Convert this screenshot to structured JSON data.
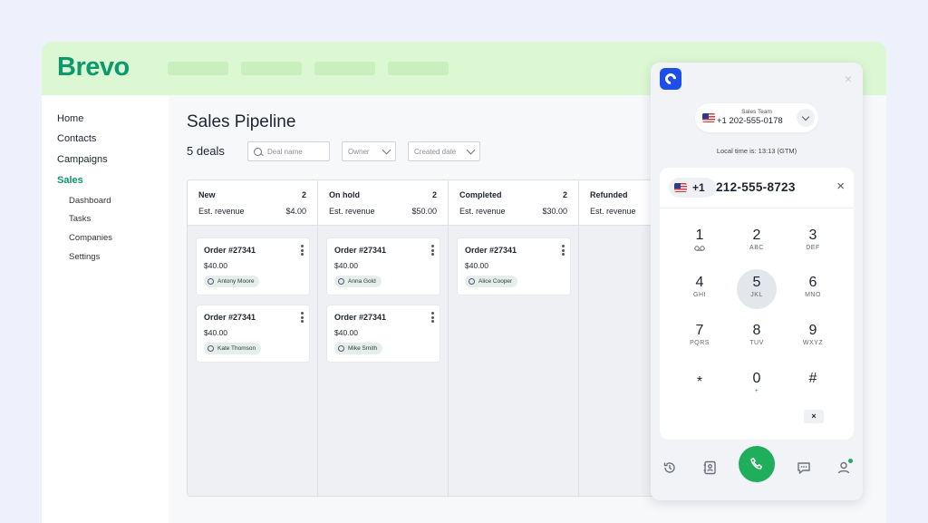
{
  "brand": {
    "logo": "Brevo"
  },
  "sidebar": {
    "items": [
      {
        "label": "Home"
      },
      {
        "label": "Contacts"
      },
      {
        "label": "Campaigns"
      },
      {
        "label": "Sales"
      }
    ],
    "sub_items": [
      {
        "label": "Dashboard"
      },
      {
        "label": "Tasks"
      },
      {
        "label": "Companies"
      },
      {
        "label": "Settings"
      }
    ]
  },
  "main": {
    "title": "Sales Pipeline",
    "deals_count": "5 deals",
    "filters": {
      "search_placeholder": "Deal name",
      "owner": "Owner",
      "created_date": "Created date"
    }
  },
  "pipeline": {
    "columns": [
      {
        "name": "New",
        "count": "2",
        "revenue_label": "Est. revenue",
        "revenue": "$4.00",
        "cards": [
          {
            "title": "Order #27341",
            "amount": "$40.00",
            "owner": "Antony Moore"
          },
          {
            "title": "Order #27341",
            "amount": "$40.00",
            "owner": "Kate Thomson"
          }
        ]
      },
      {
        "name": "On hold",
        "count": "2",
        "revenue_label": "Est. revenue",
        "revenue": "$50.00",
        "cards": [
          {
            "title": "Order #27341",
            "amount": "$40.00",
            "owner": "Anna Gold"
          },
          {
            "title": "Order #27341",
            "amount": "$40.00",
            "owner": "Mike Smith"
          }
        ]
      },
      {
        "name": "Completed",
        "count": "2",
        "revenue_label": "Est. revenue",
        "revenue": "$30.00",
        "cards": [
          {
            "title": "Order #27341",
            "amount": "$40.00",
            "owner": "Alice Cooper"
          }
        ]
      },
      {
        "name": "Refunded",
        "count": "",
        "revenue_label": "Est. revenue",
        "revenue": "",
        "cards": []
      }
    ]
  },
  "dialer": {
    "logo_icon": "c-logo-icon",
    "close_glyph": "×",
    "line": {
      "label": "Sales Team",
      "number": "+1 202-555-0178"
    },
    "local_time": "Local time is: 13:13 (GTM)",
    "country_code": "+1",
    "dialed_number": "212-555-8723",
    "clear_glyph": "×",
    "keys": [
      {
        "digit": "1",
        "letters": ""
      },
      {
        "digit": "2",
        "letters": "ABC"
      },
      {
        "digit": "3",
        "letters": "DEF"
      },
      {
        "digit": "4",
        "letters": "GHI"
      },
      {
        "digit": "5",
        "letters": "JKL"
      },
      {
        "digit": "6",
        "letters": "MNO"
      },
      {
        "digit": "7",
        "letters": "PQRS"
      },
      {
        "digit": "8",
        "letters": "TUV"
      },
      {
        "digit": "9",
        "letters": "WXYZ"
      },
      {
        "digit": "*",
        "letters": ""
      },
      {
        "digit": "0",
        "letters": "+"
      },
      {
        "digit": "#",
        "letters": ""
      }
    ],
    "pressed_key": "5",
    "backspace_glyph": "×",
    "footer_icons": [
      "history-icon",
      "contacts-book-icon",
      "phone-icon",
      "chat-icon",
      "user-icon"
    ],
    "colors": {
      "call": "#1fae5b",
      "brand": "#1d4fe8"
    }
  },
  "colors": {
    "brand_green": "#0b996e",
    "topbar": "#dcf8d3"
  }
}
